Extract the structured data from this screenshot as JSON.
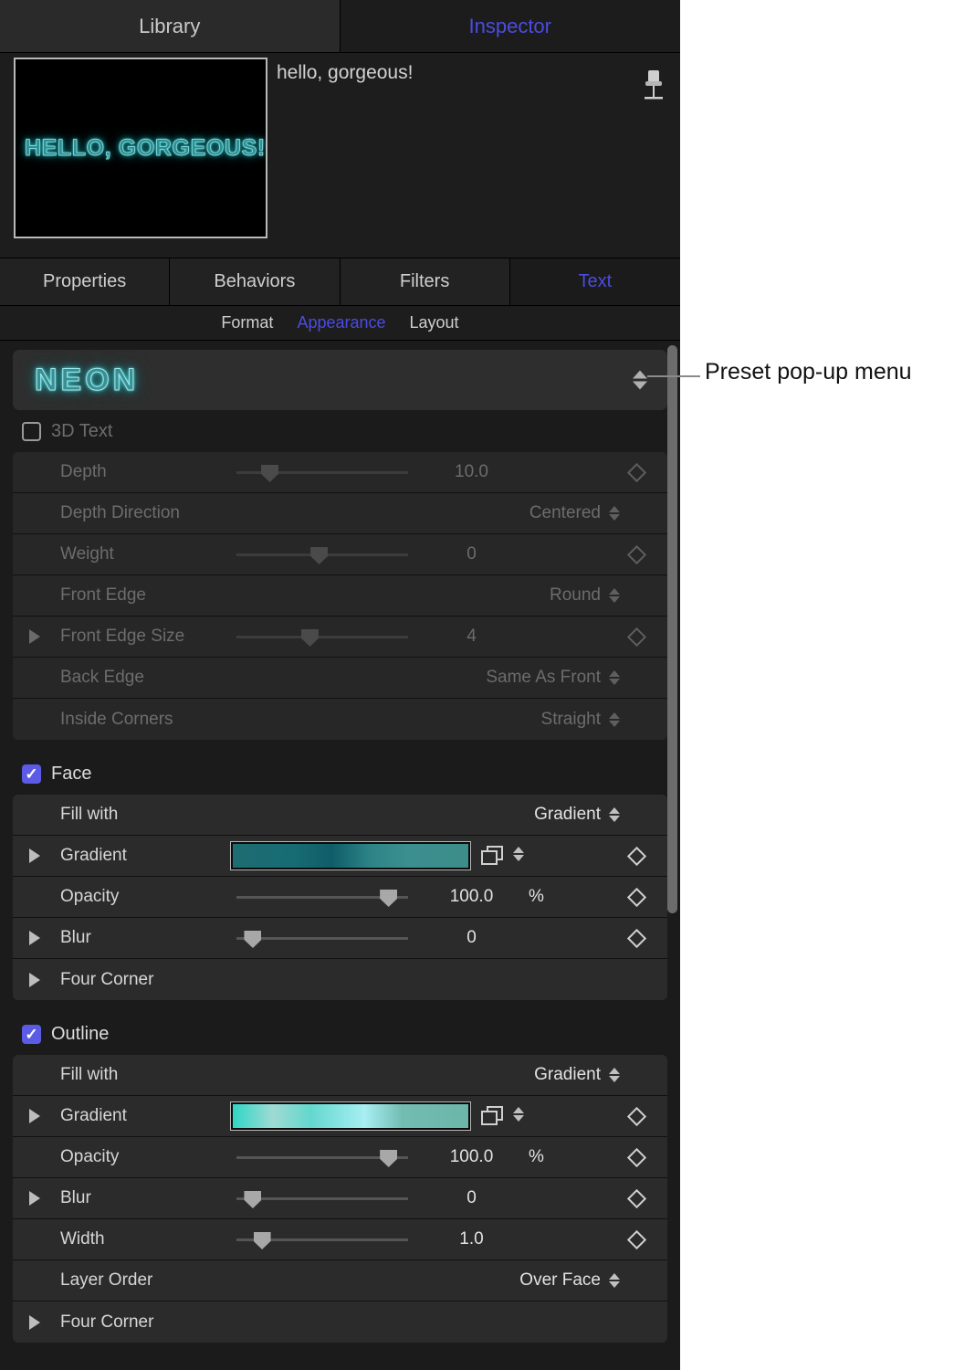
{
  "top_tabs": [
    {
      "label": "Library",
      "active": false
    },
    {
      "label": "Inspector",
      "active": true
    }
  ],
  "preview": {
    "thumbnail_text": "HELLO, GORGEOUS!",
    "title": "hello, gorgeous!",
    "pin_icon": "pin-icon"
  },
  "inspector_tabs": [
    {
      "label": "Properties",
      "active": false
    },
    {
      "label": "Behaviors",
      "active": false
    },
    {
      "label": "Filters",
      "active": false
    },
    {
      "label": "Text",
      "active": true
    }
  ],
  "sub_tabs": [
    {
      "label": "Format",
      "active": false
    },
    {
      "label": "Appearance",
      "active": true
    },
    {
      "label": "Layout",
      "active": false
    }
  ],
  "preset": {
    "label": "NEON",
    "stepper_icon": "stepper-updown-icon"
  },
  "sections": [
    {
      "id": "three-d-text",
      "title": "3D Text",
      "checked": false,
      "disabled": true,
      "rows": [
        {
          "label": "Depth",
          "kind": "slider",
          "value": "10.0",
          "thumb_pct": 16,
          "disclosure": false,
          "keyframe": true
        },
        {
          "label": "Depth Direction",
          "kind": "popup",
          "value": "Centered",
          "disclosure": false,
          "keyframe": false
        },
        {
          "label": "Weight",
          "kind": "slider",
          "value": "0",
          "thumb_pct": 48,
          "disclosure": false,
          "keyframe": true
        },
        {
          "label": "Front Edge",
          "kind": "popup",
          "value": "Round",
          "disclosure": false,
          "keyframe": false
        },
        {
          "label": "Front Edge Size",
          "kind": "slider",
          "value": "4",
          "thumb_pct": 42,
          "disclosure": true,
          "keyframe": true
        },
        {
          "label": "Back Edge",
          "kind": "popup",
          "value": "Same As Front",
          "disclosure": false,
          "keyframe": false
        },
        {
          "label": "Inside Corners",
          "kind": "popup",
          "value": "Straight",
          "disclosure": false,
          "keyframe": false
        }
      ]
    },
    {
      "id": "face",
      "title": "Face",
      "checked": true,
      "disabled": false,
      "rows": [
        {
          "label": "Fill with",
          "kind": "popup",
          "value": "Gradient",
          "disclosure": false,
          "keyframe": false
        },
        {
          "label": "Gradient",
          "kind": "gradient",
          "gradient": "face",
          "disclosure": true,
          "keyframe": true
        },
        {
          "label": "Opacity",
          "kind": "slider",
          "value": "100.0",
          "unit": "%",
          "thumb_pct": 93,
          "disclosure": false,
          "keyframe": true
        },
        {
          "label": "Blur",
          "kind": "slider",
          "value": "0",
          "thumb_pct": 5,
          "disclosure": true,
          "keyframe": true
        },
        {
          "label": "Four Corner",
          "kind": "plain",
          "disclosure": true,
          "keyframe": false
        }
      ]
    },
    {
      "id": "outline",
      "title": "Outline",
      "checked": true,
      "disabled": false,
      "rows": [
        {
          "label": "Fill with",
          "kind": "popup",
          "value": "Gradient",
          "disclosure": false,
          "keyframe": false
        },
        {
          "label": "Gradient",
          "kind": "gradient",
          "gradient": "outline",
          "disclosure": true,
          "keyframe": true
        },
        {
          "label": "Opacity",
          "kind": "slider",
          "value": "100.0",
          "unit": "%",
          "thumb_pct": 93,
          "disclosure": false,
          "keyframe": true
        },
        {
          "label": "Blur",
          "kind": "slider",
          "value": "0",
          "thumb_pct": 5,
          "disclosure": true,
          "keyframe": true
        },
        {
          "label": "Width",
          "kind": "slider",
          "value": "1.0",
          "thumb_pct": 11,
          "disclosure": false,
          "keyframe": true
        },
        {
          "label": "Layer Order",
          "kind": "popup",
          "value": "Over Face",
          "disclosure": false,
          "keyframe": false
        },
        {
          "label": "Four Corner",
          "kind": "plain",
          "disclosure": true,
          "keyframe": false
        }
      ]
    }
  ],
  "callout": {
    "text": "Preset pop-up menu"
  },
  "colors": {
    "accent": "#4b4be2",
    "checkbox": "#5b5be6",
    "panel_bg": "#1b1b1b",
    "row_bg": "#2b2b2b",
    "neon_teal": "#3b8f93"
  },
  "gradients": {
    "face": "linear-gradient(90deg,#1d6d72 0%,#176b73 26%,#0f5d68 42%,#2c8386 58%,#3b8f8e 74%,#3d8d8a 100%)",
    "outline": "linear-gradient(90deg,#2fd6c6 0%,#9fdad4 17%,#63d8ce 33%,#8fe6e6 48%,#a8eef2 56%,#72bcb2 72%,#6bb5a9 100%)"
  }
}
